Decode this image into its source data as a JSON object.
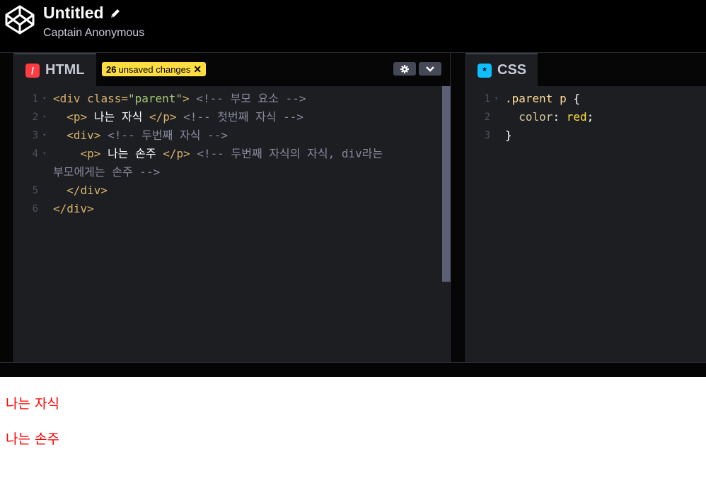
{
  "header": {
    "title": "Untitled",
    "author": "Captain Anonymous"
  },
  "html_pane": {
    "tab_label": "HTML",
    "tab_icon": "html-icon",
    "badge_count": "26",
    "badge_text": "unsaved changes",
    "badge_close": "✕",
    "lines": [
      {
        "n": "1",
        "fold": "▾",
        "parts": [
          [
            "tag",
            "<div "
          ],
          [
            "attr",
            "class="
          ],
          [
            "val",
            "\"parent\""
          ],
          [
            "tag",
            ">"
          ],
          [
            "cmt",
            " <!-- 부모 요소 -->"
          ]
        ]
      },
      {
        "n": "2",
        "fold": "▾",
        "parts": [
          [
            "tag",
            "  <p>"
          ],
          [
            "plain",
            " 나는 자식 "
          ],
          [
            "tag",
            "</p>"
          ],
          [
            "cmt",
            " <!-- 첫번째 자식 -->"
          ]
        ]
      },
      {
        "n": "3",
        "fold": "▾",
        "parts": [
          [
            "tag",
            "  <div>"
          ],
          [
            "cmt",
            " <!-- 두번째 자식 -->"
          ]
        ]
      },
      {
        "n": "4",
        "fold": "▾",
        "parts": [
          [
            "tag",
            "    <p>"
          ],
          [
            "plain",
            " 나는 손주 "
          ],
          [
            "tag",
            "</p>"
          ],
          [
            "cmt",
            " <!-- 두번째 자식의 자식, div라는"
          ]
        ]
      },
      {
        "n": "",
        "fold": "",
        "parts": [
          [
            "cmt",
            "부모에게는 손주 -->"
          ]
        ]
      },
      {
        "n": "5",
        "fold": "",
        "parts": [
          [
            "tag",
            "  </div>"
          ]
        ]
      },
      {
        "n": "6",
        "fold": "",
        "parts": [
          [
            "tag",
            "</div>"
          ]
        ]
      }
    ]
  },
  "css_pane": {
    "tab_label": "CSS",
    "tab_icon": "css-icon",
    "lines": [
      {
        "n": "1",
        "fold": "▾",
        "parts": [
          [
            "sel",
            ".parent p"
          ],
          [
            "punc",
            " {"
          ]
        ]
      },
      {
        "n": "2",
        "fold": "",
        "parts": [
          [
            "prop",
            "  color"
          ],
          [
            "punc",
            ": "
          ],
          [
            "cssval",
            "red"
          ],
          [
            "punc",
            ";"
          ]
        ]
      },
      {
        "n": "3",
        "fold": "",
        "parts": [
          [
            "punc",
            "}"
          ]
        ]
      }
    ]
  },
  "result": {
    "child_text": "나는 자식",
    "grandchild_text": "나는 손주"
  },
  "colors": {
    "brand_yellow": "#ffdd40",
    "html_red": "#ff3c41",
    "css_blue": "#0ebeff",
    "result_red": "#ff0000"
  }
}
